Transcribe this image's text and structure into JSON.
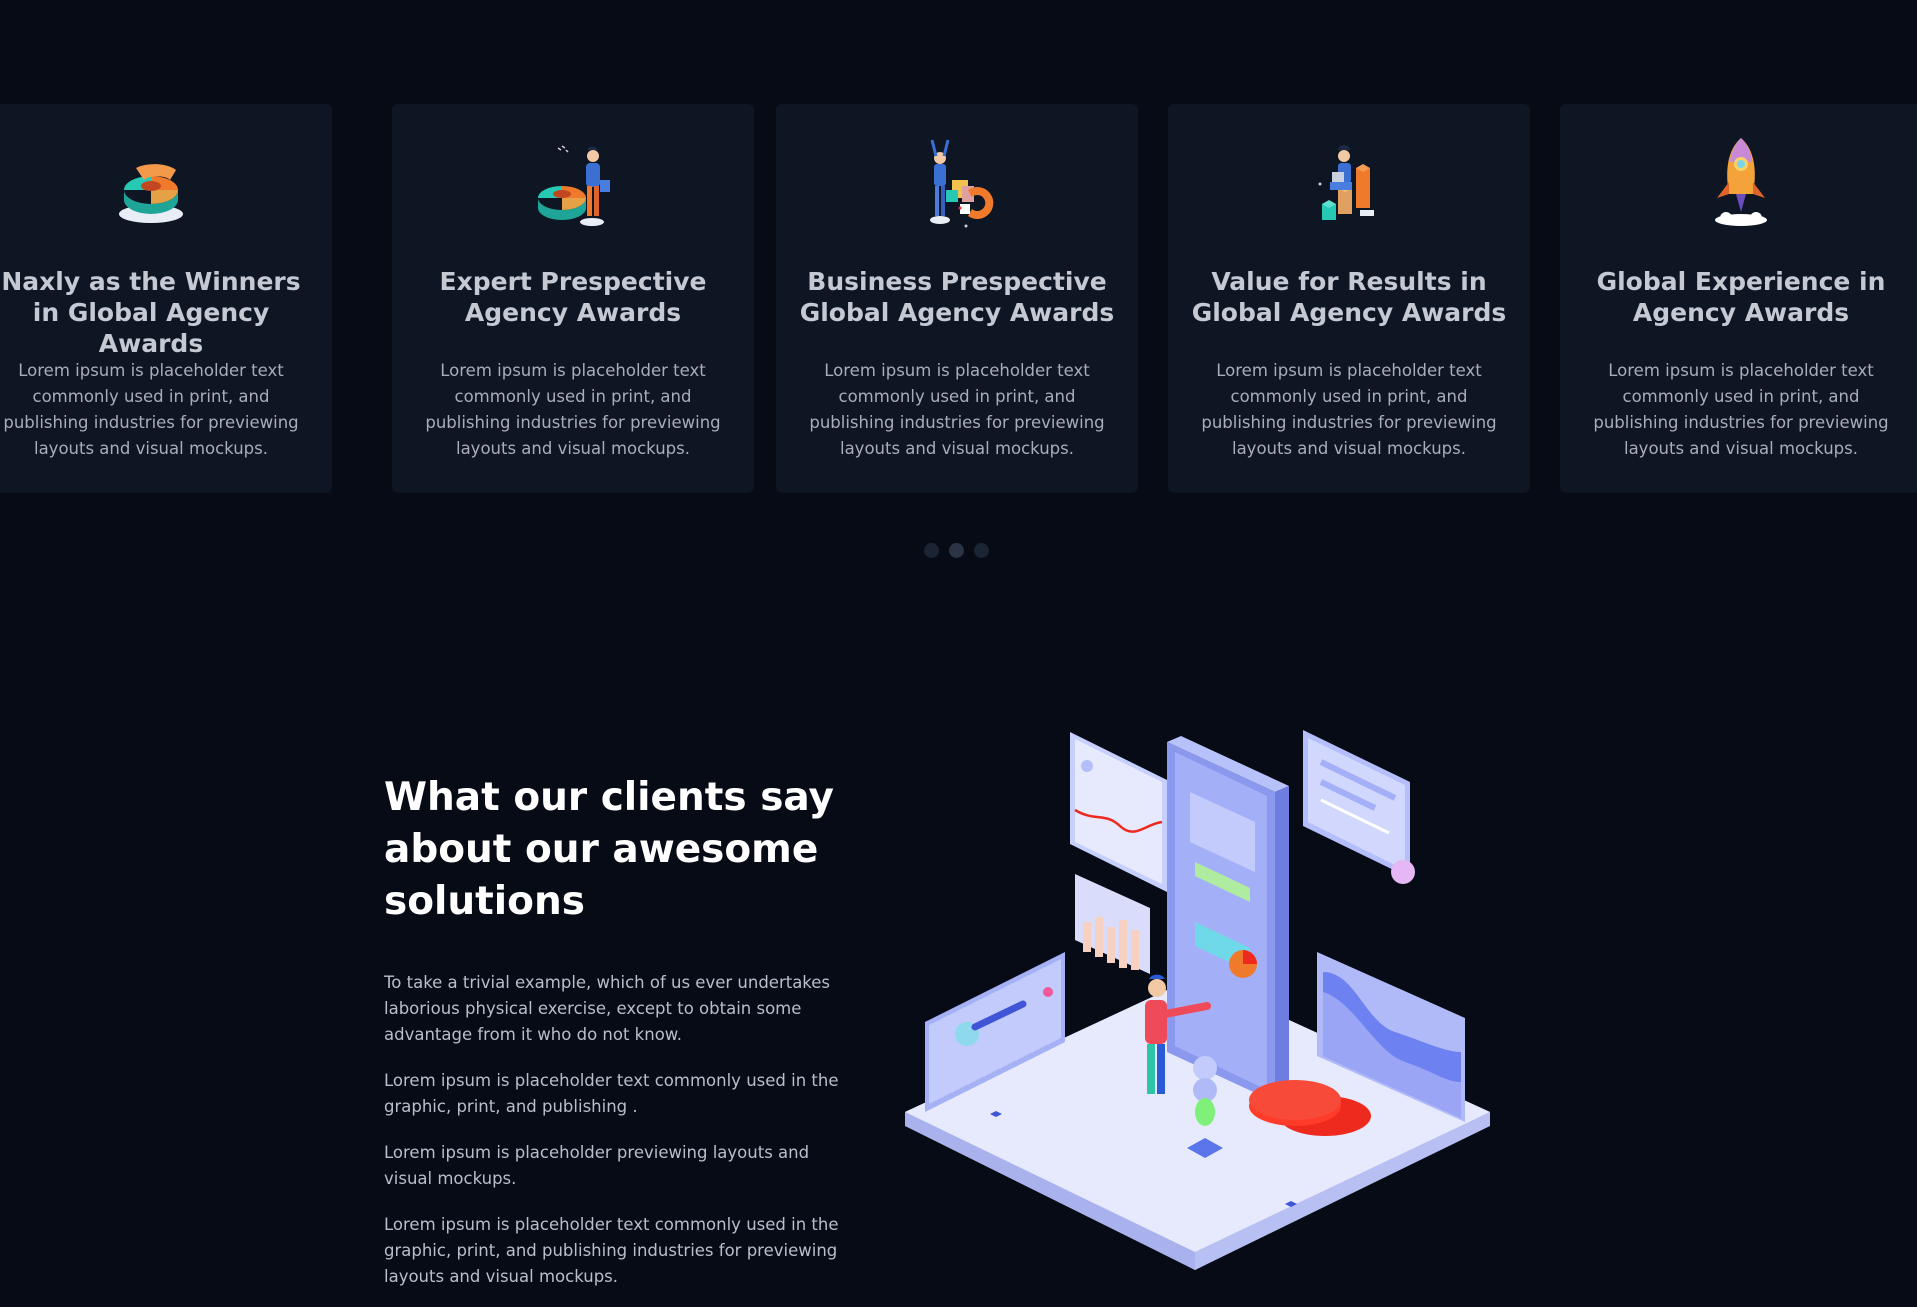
{
  "cards": [
    {
      "icon": "pie-chart-icon",
      "title": "Naxly as the Winners in Global Agency Awards",
      "text": "Lorem ipsum is placeholder text commonly used in print, and publishing industries for previewing layouts and visual mockups."
    },
    {
      "icon": "person-chart-icon",
      "title": "Expert Prespective Agency Awards",
      "text": "Lorem ipsum is placeholder text commonly used in print, and publishing industries for previewing layouts and visual mockups."
    },
    {
      "icon": "magnet-blocks-icon",
      "title": "Business Prespective Global Agency Awards",
      "text": "Lorem ipsum is placeholder text commonly used in print, and publishing industries for previewing layouts and visual mockups."
    },
    {
      "icon": "person-bars-icon",
      "title": "Value for Results in Global Agency Awards",
      "text": "Lorem ipsum is placeholder text commonly used in print, and publishing industries for previewing layouts and visual mockups."
    },
    {
      "icon": "rocket-icon",
      "title": "Global Experience in Agency Awards",
      "text": "Lorem ipsum is placeholder text commonly used in print, and publishing industries for previewing layouts and visual mockups."
    }
  ],
  "carousel": {
    "dot_count": 3,
    "active_dot": 2
  },
  "clients": {
    "heading": "What our clients say about our awesome solutions",
    "paragraphs": [
      "To take a trivial example, which of us ever undertakes laborious physical exercise, except to obtain some advantage from it who do not know.",
      "Lorem ipsum is placeholder text commonly used in the graphic, print, and publishing .",
      "Lorem ipsum is placeholder previewing layouts and visual mockups.",
      "Lorem ipsum is placeholder text commonly used in the graphic, print, and publishing industries for previewing layouts and visual mockups."
    ],
    "illustration": "isometric-phone-dashboard-illustration"
  },
  "colors": {
    "background": "#060b16",
    "card": "#0e1523",
    "heading": "#ffffff",
    "card_title": "#c4c9d3",
    "body_text": "#b9bfca",
    "accent_orange": "#f07a2c",
    "accent_teal": "#27c9b5",
    "accent_red": "#ee2a1e",
    "accent_periwinkle": "#a7b4ff"
  }
}
